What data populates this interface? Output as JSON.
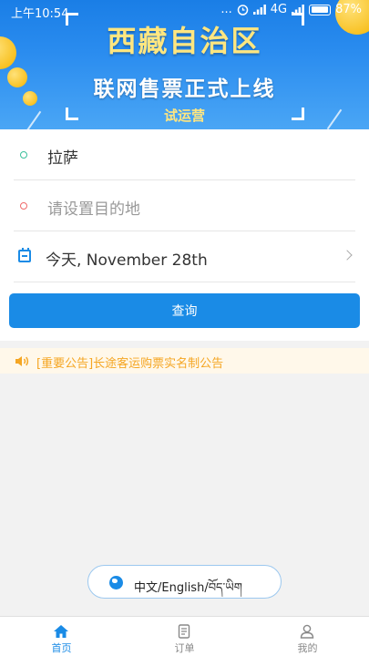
{
  "status_bar": {
    "time": "上午10:54",
    "dots": "...",
    "network": "4G",
    "battery": "87%"
  },
  "banner": {
    "line1": "西藏自治区",
    "line2": "联网售票正式上线",
    "line3": "试运营"
  },
  "form": {
    "origin": "拉萨",
    "destination_placeholder": "请设置目的地",
    "date": "今天, November  28th",
    "query_label": "查询"
  },
  "notice": {
    "text": "[重要公告]长途客运购票实名制公告"
  },
  "language": {
    "label": "中文/English/བོད་ཡིག"
  },
  "tabbar": {
    "items": [
      {
        "label": "首页",
        "icon": "home-icon",
        "active": true
      },
      {
        "label": "订单",
        "icon": "order-icon",
        "active": false
      },
      {
        "label": "我的",
        "icon": "profile-icon",
        "active": false
      }
    ]
  },
  "colors": {
    "accent": "#1a8be6",
    "notice_text": "#f5a623",
    "origin_dot": "#3bbf9b",
    "destination_dot": "#ef6b6b"
  }
}
